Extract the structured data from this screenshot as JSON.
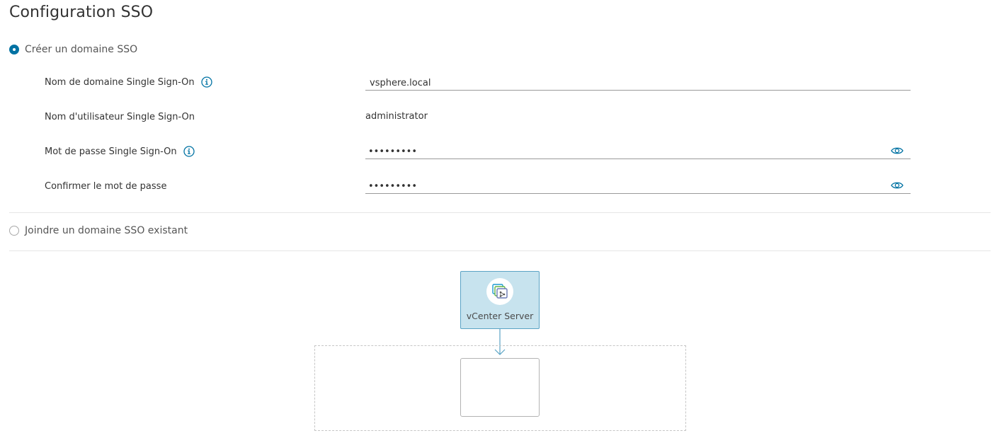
{
  "page": {
    "title": "Configuration SSO"
  },
  "options": {
    "create": {
      "label": "Créer un domaine SSO",
      "selected": true
    },
    "join": {
      "label": "Joindre un domaine SSO existant",
      "selected": false
    }
  },
  "form": {
    "domain_name": {
      "label": "Nom de domaine Single Sign-On",
      "value": "vsphere.local"
    },
    "username": {
      "label": "Nom d'utilisateur Single Sign-On",
      "value": "administrator"
    },
    "password": {
      "label": "Mot de passe Single Sign-On",
      "value": "•••••••••"
    },
    "confirm_password": {
      "label": "Confirmer le mot de passe",
      "value": "•••••••••"
    }
  },
  "topology": {
    "vcenter_label": "vCenter Server"
  },
  "colors": {
    "accent": "#0072a3",
    "card_fill": "#c7e3ee",
    "card_border": "#5aa3c5"
  }
}
